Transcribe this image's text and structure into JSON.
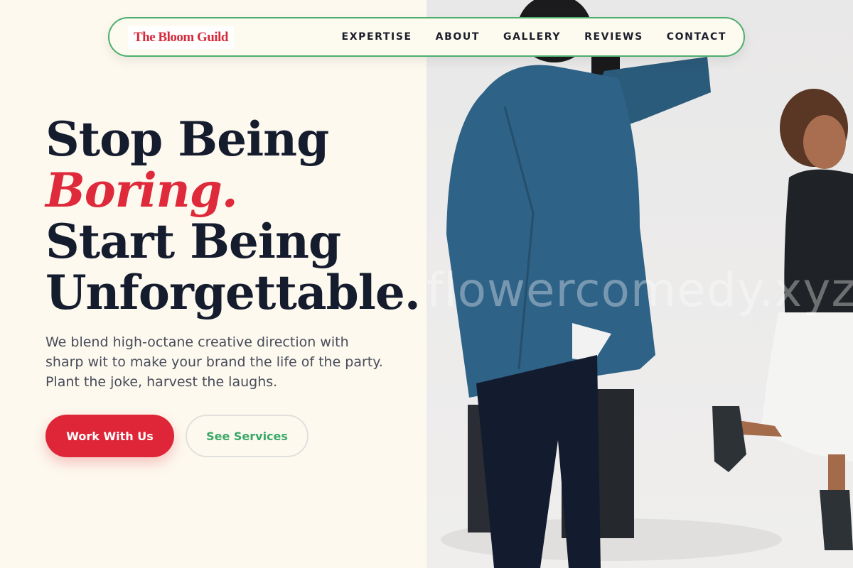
{
  "brand": {
    "logo_text": "The Bloom Guild",
    "accent_color": "#df2638",
    "green_color": "#3aa868"
  },
  "nav": {
    "links": [
      "EXPERTISE",
      "ABOUT",
      "GALLERY",
      "REVIEWS",
      "CONTACT"
    ]
  },
  "hero": {
    "line1": "Stop Being",
    "line2": "Boring.",
    "line3": "Start Being",
    "line4": "Unforgettable.",
    "subtext": "We blend high-octane creative direction with sharp wit to make your brand the life of the party. Plant the joke, harvest the laughs.",
    "primary_button": "Work With Us",
    "secondary_button": "See Services"
  },
  "photo": {
    "watermark": "flowercomedy.xyz",
    "description_icon": "photographer-photo"
  }
}
